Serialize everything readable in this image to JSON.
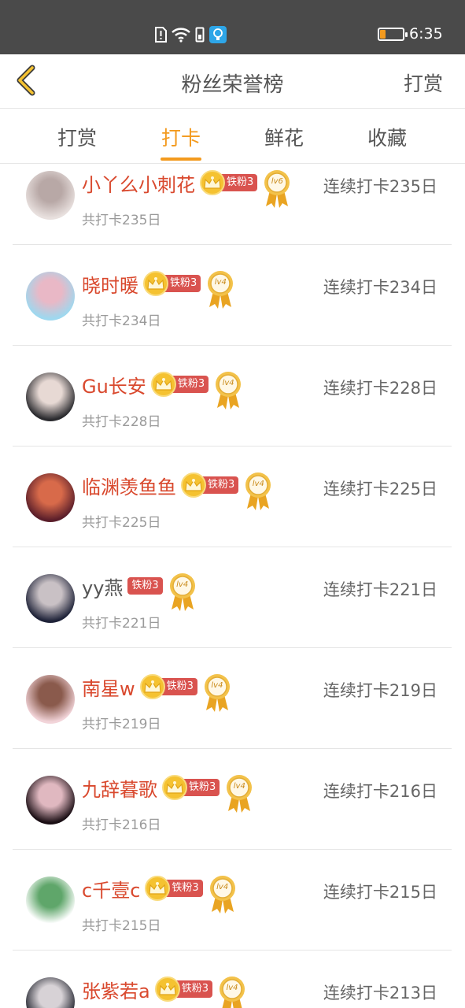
{
  "status_bar": {
    "time": "6:35",
    "icons": [
      "alert-icon",
      "wifi-icon",
      "sim-icon",
      "location-icon"
    ],
    "battery_level": 0.25
  },
  "nav": {
    "title": "粉丝荣誉榜",
    "right_action": "打赏"
  },
  "tabs": [
    {
      "label": "打赏",
      "active": false
    },
    {
      "label": "打卡",
      "active": true
    },
    {
      "label": "鲜花",
      "active": false
    },
    {
      "label": "收藏",
      "active": false
    }
  ],
  "colors": {
    "accent": "#f39a1e",
    "name_red": "#d9492e",
    "badge_red": "#d9534f",
    "crown_gold": "#f5c231"
  },
  "rows": [
    {
      "name": "小丫么小刺花",
      "crown": true,
      "fan_badge": "铁粉3",
      "level": "lv6",
      "total": "共打卡235日",
      "streak": "连续打卡235日",
      "avatar_colors": [
        "#e8e0de",
        "#b8a8a6"
      ]
    },
    {
      "name": "晓时暖",
      "crown": true,
      "fan_badge": "铁粉3",
      "level": "lv4",
      "total": "共打卡234日",
      "streak": "连续打卡234日",
      "avatar_colors": [
        "#9ed8ef",
        "#e9b8c6"
      ]
    },
    {
      "name": "Gu长安",
      "crown": true,
      "fan_badge": "铁粉3",
      "level": "lv4",
      "total": "共打卡228日",
      "streak": "连续打卡228日",
      "avatar_colors": [
        "#2a2a2e",
        "#e7d9d4"
      ]
    },
    {
      "name": "临渊羡鱼鱼",
      "crown": true,
      "fan_badge": "铁粉3",
      "level": "lv4",
      "total": "共打卡225日",
      "streak": "连续打卡225日",
      "avatar_colors": [
        "#5a1e2a",
        "#d86a4a"
      ]
    },
    {
      "name": "yy燕",
      "crown": false,
      "fan_badge": "铁粉3",
      "level": "lv4",
      "total": "共打卡221日",
      "streak": "连续打卡221日",
      "avatar_colors": [
        "#1e2238",
        "#c9c1c5"
      ]
    },
    {
      "name": "南星w",
      "crown": true,
      "fan_badge": "铁粉3",
      "level": "lv4",
      "total": "共打卡219日",
      "streak": "连续打卡219日",
      "avatar_colors": [
        "#f2d4d9",
        "#8a5a4c"
      ]
    },
    {
      "name": "九辞暮歌",
      "crown": true,
      "fan_badge": "铁粉3",
      "level": "lv4",
      "total": "共打卡216日",
      "streak": "连续打卡216日",
      "avatar_colors": [
        "#1a0e14",
        "#e0b8c0"
      ]
    },
    {
      "name": "c千壹c",
      "crown": true,
      "fan_badge": "铁粉3",
      "level": "lv4",
      "total": "共打卡215日",
      "streak": "连续打卡215日",
      "avatar_colors": [
        "#ffffff",
        "#5fa66a"
      ]
    },
    {
      "name": "张紫若a",
      "crown": true,
      "fan_badge": "铁粉3",
      "level": "lv4",
      "total": "",
      "streak": "连续打卡213日",
      "avatar_colors": [
        "#23252f",
        "#d7d2d6"
      ]
    }
  ]
}
